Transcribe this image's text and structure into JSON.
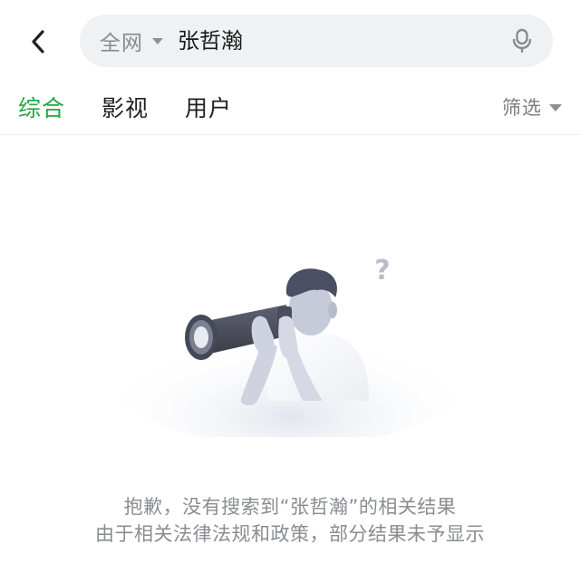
{
  "header": {
    "back_icon": "chevron-left-icon",
    "search": {
      "scope_label": "全网",
      "scope_icon": "caret-down-icon",
      "query": "张哲瀚",
      "mic_icon": "microphone-icon"
    }
  },
  "tabs": [
    {
      "label": "综合",
      "active": true
    },
    {
      "label": "影视",
      "active": false
    },
    {
      "label": "用户",
      "active": false
    }
  ],
  "filter": {
    "label": "筛选",
    "icon": "caret-down-icon"
  },
  "empty_state": {
    "illustration": "person-with-telescope-icon",
    "line1": "抱歉，没有搜索到“张哲瀚”的相关结果",
    "line2": "由于相关法律法规和政策，部分结果未予显示"
  },
  "colors": {
    "accent": "#22a645",
    "search_bg": "#f0f1f3",
    "muted_text": "#8a8c90"
  }
}
